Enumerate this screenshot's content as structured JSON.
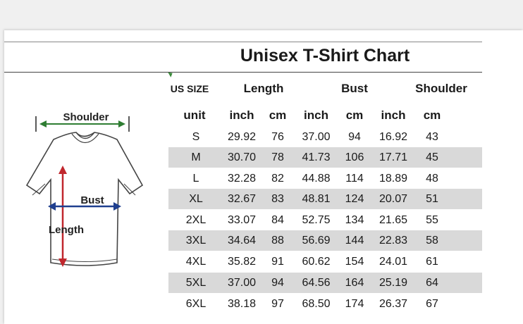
{
  "title": "Unisex T-Shirt Chart",
  "header": {
    "us_size": "US SIZE",
    "length": "Length",
    "bust": "Bust",
    "shoulder": "Shoulder"
  },
  "units": {
    "unit": "unit",
    "length_inch": "inch",
    "length_cm": "cm",
    "bust_inch": "inch",
    "bust_cm": "cm",
    "shoulder_inch": "inch",
    "shoulder_cm": "cm"
  },
  "diagram": {
    "shoulder_label": "Shoulder",
    "bust_label": "Bust",
    "length_label": "Length"
  },
  "rows": [
    [
      "S",
      "29.92",
      "76",
      "37.00",
      "94",
      "16.92",
      "43"
    ],
    [
      "M",
      "30.70",
      "78",
      "41.73",
      "106",
      "17.71",
      "45"
    ],
    [
      "L",
      "32.28",
      "82",
      "44.88",
      "114",
      "18.89",
      "48"
    ],
    [
      "XL",
      "32.67",
      "83",
      "48.81",
      "124",
      "20.07",
      "51"
    ],
    [
      "2XL",
      "33.07",
      "84",
      "52.75",
      "134",
      "21.65",
      "55"
    ],
    [
      "3XL",
      "34.64",
      "88",
      "56.69",
      "144",
      "22.83",
      "58"
    ],
    [
      "4XL",
      "35.82",
      "91",
      "60.62",
      "154",
      "24.01",
      "61"
    ],
    [
      "5XL",
      "37.00",
      "94",
      "64.56",
      "164",
      "25.19",
      "64"
    ],
    [
      "6XL",
      "38.18",
      "97",
      "68.50",
      "174",
      "26.37",
      "67"
    ]
  ],
  "colors": {
    "row_shade": "#d9d9d9",
    "arrow_red": "#c0272d",
    "arrow_blue": "#1f3f8f",
    "arrow_green": "#2e7d32"
  }
}
